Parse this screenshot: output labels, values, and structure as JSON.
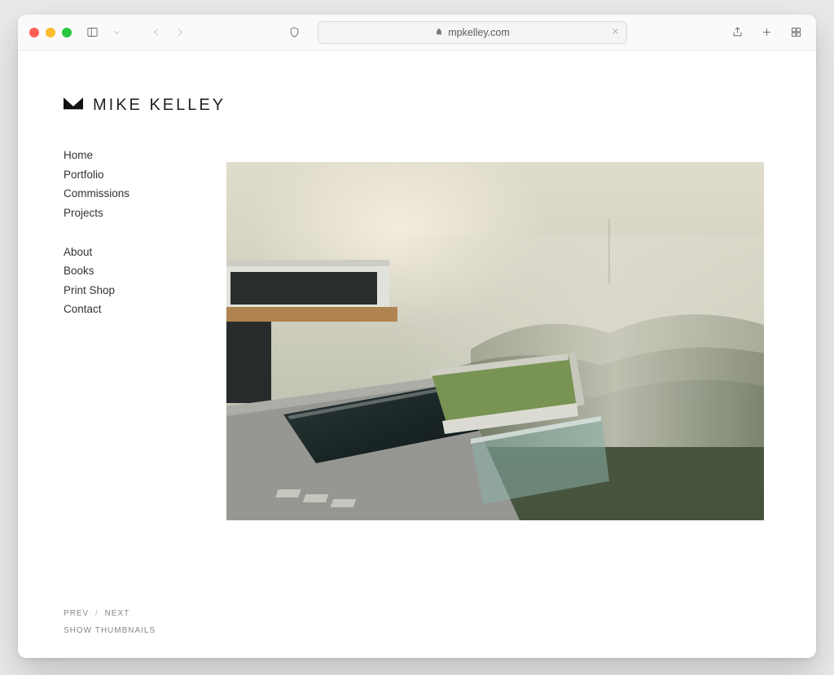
{
  "browser": {
    "url_display": "mpkelley.com"
  },
  "brand": {
    "name": "MIKE KELLEY"
  },
  "nav": {
    "group1": [
      {
        "label": "Home"
      },
      {
        "label": "Portfolio"
      },
      {
        "label": "Commissions"
      },
      {
        "label": "Projects"
      }
    ],
    "group2": [
      {
        "label": "About"
      },
      {
        "label": "Books"
      },
      {
        "label": "Print Shop"
      },
      {
        "label": "Contact"
      }
    ]
  },
  "controls": {
    "prev": "PREV",
    "next": "NEXT",
    "divider": "/",
    "thumbnails": "SHOW THUMBNAILS"
  }
}
